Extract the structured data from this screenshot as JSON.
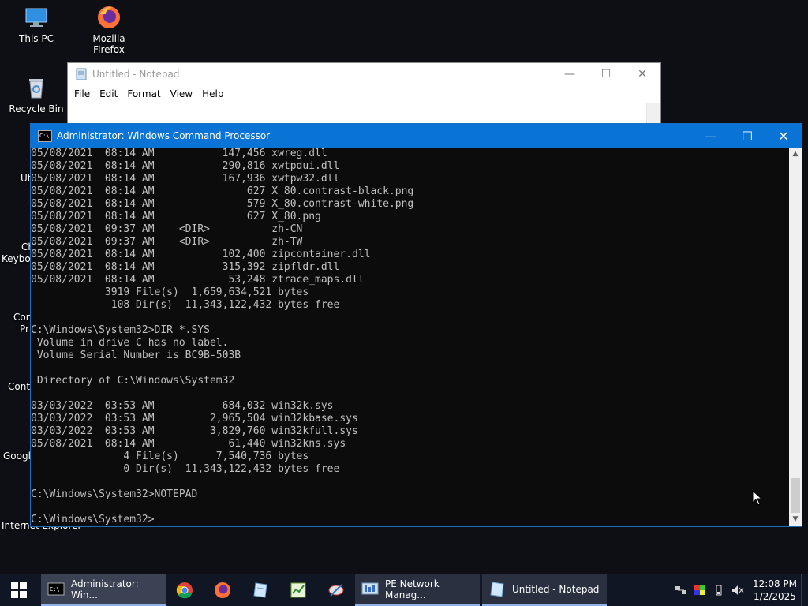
{
  "desktop": {
    "icons": [
      {
        "label": "This PC"
      },
      {
        "label": "Mozilla Firefox"
      },
      {
        "label": "Recycle Bin"
      }
    ],
    "partial_labels": [
      "Uti",
      "Ch",
      "Keybo",
      "Con",
      "Pr",
      "Contr",
      "Googl",
      "Internet Explorer"
    ]
  },
  "notepad": {
    "title": "Untitled - Notepad",
    "menu": [
      "File",
      "Edit",
      "Format",
      "View",
      "Help"
    ]
  },
  "cmd": {
    "title": "Administrator: Windows Command Processor",
    "lines": [
      "05/08/2021  08:14 AM           147,456 xwreg.dll",
      "05/08/2021  08:14 AM           290,816 xwtpdui.dll",
      "05/08/2021  08:14 AM           167,936 xwtpw32.dll",
      "05/08/2021  08:14 AM               627 X_80.contrast-black.png",
      "05/08/2021  08:14 AM               579 X_80.contrast-white.png",
      "05/08/2021  08:14 AM               627 X_80.png",
      "05/08/2021  09:37 AM    <DIR>          zh-CN",
      "05/08/2021  09:37 AM    <DIR>          zh-TW",
      "05/08/2021  08:14 AM           102,400 zipcontainer.dll",
      "05/08/2021  08:14 AM           315,392 zipfldr.dll",
      "05/08/2021  08:14 AM            53,248 ztrace_maps.dll",
      "            3919 File(s)  1,659,634,521 bytes",
      "             108 Dir(s)  11,343,122,432 bytes free",
      "",
      "C:\\Windows\\System32>DIR *.SYS",
      " Volume in drive C has no label.",
      " Volume Serial Number is BC9B-503B",
      "",
      " Directory of C:\\Windows\\System32",
      "",
      "03/03/2022  03:53 AM           684,032 win32k.sys",
      "03/03/2022  03:53 AM         2,965,504 win32kbase.sys",
      "03/03/2022  03:53 AM         3,829,760 win32kfull.sys",
      "05/08/2021  08:14 AM            61,440 win32kns.sys",
      "               4 File(s)      7,540,736 bytes",
      "               0 Dir(s)  11,343,122,432 bytes free",
      "",
      "C:\\Windows\\System32>NOTEPAD",
      "",
      "C:\\Windows\\System32>"
    ]
  },
  "taskbar": {
    "apps": [
      {
        "label": "Administrator: Win..."
      },
      {
        "label": "PE Network Manag..."
      },
      {
        "label": "Untitled - Notepad"
      }
    ],
    "clock": {
      "time": "12:08 PM",
      "date": "1/2/2025"
    }
  },
  "colors": {
    "cmd_title": "#0a74d6",
    "taskbar": "#101624",
    "console_text": "#c0c0c0"
  }
}
